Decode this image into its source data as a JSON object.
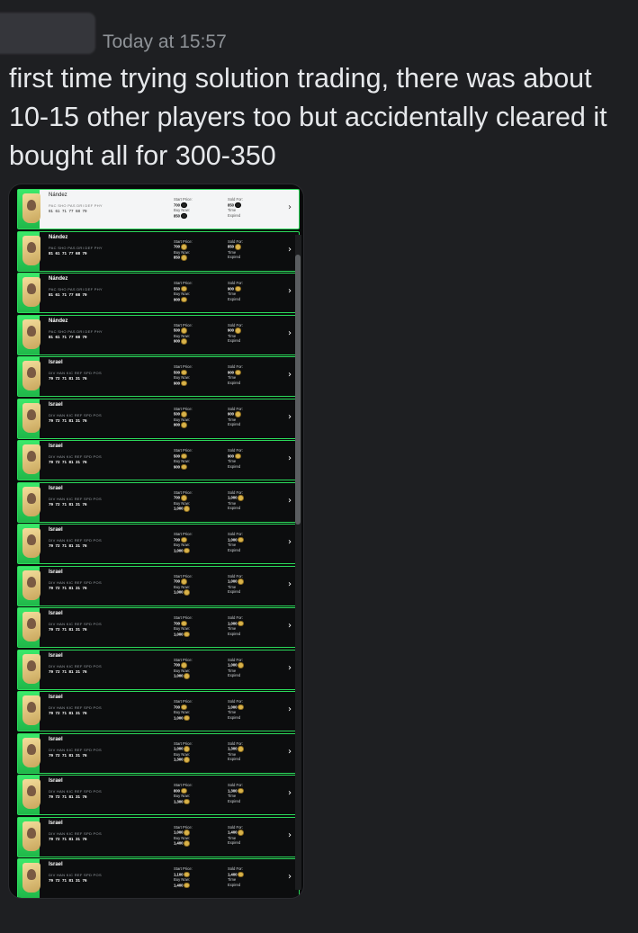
{
  "header": {
    "timestamp": "Today at 15:57"
  },
  "message": {
    "lines": [
      "first time trying solution trading, there was about",
      "10-15 other players too but accidentally cleared it",
      "bought all for 300-350"
    ]
  },
  "labels": {
    "start_price": "Start Price:",
    "buy_now": "Buy Now:",
    "sold_for": "Sold For:",
    "time": "Time",
    "expired": "Expired",
    "chevron": "›"
  },
  "rows": [
    {
      "name": "Nández",
      "stat_labels": "PAC SHO PAS DRI DEF PHY",
      "stat_values": "81  61  71  77  68  79",
      "start": "700",
      "buy_now": "850",
      "sold": "850"
    },
    {
      "name": "Nández",
      "stat_labels": "PAC SHO PAS DRI DEF PHY",
      "stat_values": "81  61  71  77  68  79",
      "start": "700",
      "buy_now": "850",
      "sold": "850"
    },
    {
      "name": "Nández",
      "stat_labels": "PAC SHO PAS DRI DEF PHY",
      "stat_values": "81  61  71  77  68  79",
      "start": "550",
      "buy_now": "900",
      "sold": "900"
    },
    {
      "name": "Nández",
      "stat_labels": "PAC SHO PAS DRI DEF PHY",
      "stat_values": "81  61  71  77  68  79",
      "start": "500",
      "buy_now": "900",
      "sold": "900"
    },
    {
      "name": "Israel",
      "stat_labels": "DIV HAN KIC REF SPD POS",
      "stat_values": "79  72  71  81  31  76",
      "start": "500",
      "buy_now": "900",
      "sold": "900"
    },
    {
      "name": "Israel",
      "stat_labels": "DIV HAN KIC REF SPD POS",
      "stat_values": "79  72  71  81  31  76",
      "start": "500",
      "buy_now": "900",
      "sold": "900"
    },
    {
      "name": "Israel",
      "stat_labels": "DIV HAN KIC REF SPD POS",
      "stat_values": "79  72  71  81  31  76",
      "start": "500",
      "buy_now": "900",
      "sold": "900"
    },
    {
      "name": "Israel",
      "stat_labels": "DIV HAN KIC REF SPD POS",
      "stat_values": "79  72  71  81  31  76",
      "start": "700",
      "buy_now": "1,000",
      "sold": "1,000"
    },
    {
      "name": "Israel",
      "stat_labels": "DIV HAN KIC REF SPD POS",
      "stat_values": "79  72  71  81  31  76",
      "start": "700",
      "buy_now": "1,000",
      "sold": "1,000"
    },
    {
      "name": "Israel",
      "stat_labels": "DIV HAN KIC REF SPD POS",
      "stat_values": "79  72  71  81  31  76",
      "start": "700",
      "buy_now": "1,000",
      "sold": "1,000"
    },
    {
      "name": "Israel",
      "stat_labels": "DIV HAN KIC REF SPD POS",
      "stat_values": "79  72  71  81  31  76",
      "start": "700",
      "buy_now": "1,000",
      "sold": "1,000"
    },
    {
      "name": "Israel",
      "stat_labels": "DIV HAN KIC REF SPD POS",
      "stat_values": "79  72  71  81  31  76",
      "start": "700",
      "buy_now": "1,000",
      "sold": "1,000"
    },
    {
      "name": "Israel",
      "stat_labels": "DIV HAN KIC REF SPD POS",
      "stat_values": "79  72  71  81  31  76",
      "start": "700",
      "buy_now": "1,000",
      "sold": "1,000"
    },
    {
      "name": "Israel",
      "stat_labels": "DIV HAN KIC REF SPD POS",
      "stat_values": "79  72  71  81  31  76",
      "start": "1,000",
      "buy_now": "1,300",
      "sold": "1,300"
    },
    {
      "name": "Israel",
      "stat_labels": "DIV HAN KIC REF SPD POS",
      "stat_values": "79  72  71  81  31  76",
      "start": "800",
      "buy_now": "1,300",
      "sold": "1,300"
    },
    {
      "name": "Israel",
      "stat_labels": "DIV HAN KIC REF SPD POS",
      "stat_values": "79  72  71  81  31  76",
      "start": "1,000",
      "buy_now": "1,400",
      "sold": "1,400"
    },
    {
      "name": "Israel",
      "stat_labels": "DIV HAN KIC REF SPD POS",
      "stat_values": "79  72  71  81  31  76",
      "start": "1,100",
      "buy_now": "1,400",
      "sold": "1,400"
    }
  ]
}
